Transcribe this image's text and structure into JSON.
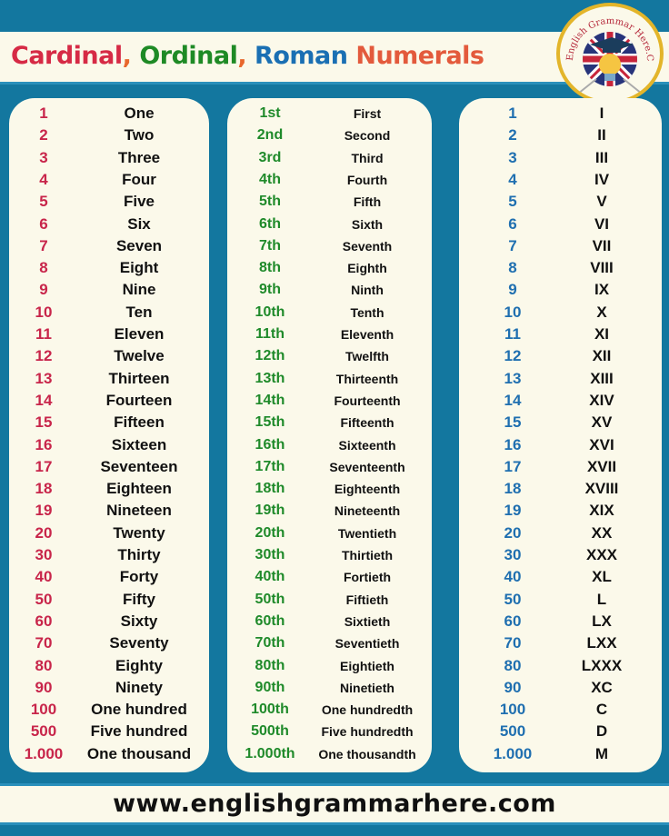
{
  "header": {
    "title_parts": {
      "cardinal": "Cardinal",
      "comma1": ",",
      "ordinal": "Ordinal",
      "comma2": ",",
      "roman": "Roman",
      "numerals": "Numerals"
    },
    "logo": {
      "text": "English Grammar Here.Com",
      "icon": "graduation-cap-lightbulb-uk-flag-icon"
    }
  },
  "colors": {
    "background": "#13779f",
    "panel": "#fbf9ea",
    "cardinal": "#c8254a",
    "ordinal": "#1f8a2a",
    "roman": "#1f6fb0",
    "numerals_title": "#e35a3c"
  },
  "cardinal": [
    {
      "num": "1",
      "word": "One"
    },
    {
      "num": "2",
      "word": "Two"
    },
    {
      "num": "3",
      "word": "Three"
    },
    {
      "num": "4",
      "word": "Four"
    },
    {
      "num": "5",
      "word": "Five"
    },
    {
      "num": "6",
      "word": "Six"
    },
    {
      "num": "7",
      "word": "Seven"
    },
    {
      "num": "8",
      "word": "Eight"
    },
    {
      "num": "9",
      "word": "Nine"
    },
    {
      "num": "10",
      "word": "Ten"
    },
    {
      "num": "11",
      "word": "Eleven"
    },
    {
      "num": "12",
      "word": "Twelve"
    },
    {
      "num": "13",
      "word": "Thirteen"
    },
    {
      "num": "14",
      "word": "Fourteen"
    },
    {
      "num": "15",
      "word": "Fifteen"
    },
    {
      "num": "16",
      "word": "Sixteen"
    },
    {
      "num": "17",
      "word": "Seventeen"
    },
    {
      "num": "18",
      "word": "Eighteen"
    },
    {
      "num": "19",
      "word": "Nineteen"
    },
    {
      "num": "20",
      "word": "Twenty"
    },
    {
      "num": "30",
      "word": "Thirty"
    },
    {
      "num": "40",
      "word": "Forty"
    },
    {
      "num": "50",
      "word": "Fifty"
    },
    {
      "num": "60",
      "word": "Sixty"
    },
    {
      "num": "70",
      "word": "Seventy"
    },
    {
      "num": "80",
      "word": "Eighty"
    },
    {
      "num": "90",
      "word": "Ninety"
    },
    {
      "num": "100",
      "word": "One hundred"
    },
    {
      "num": "500",
      "word": "Five hundred"
    },
    {
      "num": "1.000",
      "word": "One thousand"
    }
  ],
  "ordinal": [
    {
      "num": "1st",
      "word": "First"
    },
    {
      "num": "2nd",
      "word": "Second"
    },
    {
      "num": "3rd",
      "word": "Third"
    },
    {
      "num": "4th",
      "word": "Fourth"
    },
    {
      "num": "5th",
      "word": "Fifth"
    },
    {
      "num": "6th",
      "word": "Sixth"
    },
    {
      "num": "7th",
      "word": "Seventh"
    },
    {
      "num": "8th",
      "word": "Eighth"
    },
    {
      "num": "9th",
      "word": "Ninth"
    },
    {
      "num": "10th",
      "word": "Tenth"
    },
    {
      "num": "11th",
      "word": "Eleventh"
    },
    {
      "num": "12th",
      "word": "Twelfth"
    },
    {
      "num": "13th",
      "word": "Thirteenth"
    },
    {
      "num": "14th",
      "word": "Fourteenth"
    },
    {
      "num": "15th",
      "word": "Fifteenth"
    },
    {
      "num": "16th",
      "word": "Sixteenth"
    },
    {
      "num": "17th",
      "word": "Seventeenth"
    },
    {
      "num": "18th",
      "word": "Eighteenth"
    },
    {
      "num": "19th",
      "word": "Nineteenth"
    },
    {
      "num": "20th",
      "word": "Twentieth"
    },
    {
      "num": "30th",
      "word": "Thirtieth"
    },
    {
      "num": "40th",
      "word": "Fortieth"
    },
    {
      "num": "50th",
      "word": "Fiftieth"
    },
    {
      "num": "60th",
      "word": "Sixtieth"
    },
    {
      "num": "70th",
      "word": "Seventieth"
    },
    {
      "num": "80th",
      "word": "Eightieth"
    },
    {
      "num": "90th",
      "word": "Ninetieth"
    },
    {
      "num": "100th",
      "word": "One hundredth"
    },
    {
      "num": "500th",
      "word": "Five hundredth"
    },
    {
      "num": "1.000th",
      "word": "One thousandth"
    }
  ],
  "roman": [
    {
      "num": "1",
      "word": "I"
    },
    {
      "num": "2",
      "word": "II"
    },
    {
      "num": "3",
      "word": "III"
    },
    {
      "num": "4",
      "word": "IV"
    },
    {
      "num": "5",
      "word": "V"
    },
    {
      "num": "6",
      "word": "VI"
    },
    {
      "num": "7",
      "word": "VII"
    },
    {
      "num": "8",
      "word": "VIII"
    },
    {
      "num": "9",
      "word": "IX"
    },
    {
      "num": "10",
      "word": "X"
    },
    {
      "num": "11",
      "word": "XI"
    },
    {
      "num": "12",
      "word": "XII"
    },
    {
      "num": "13",
      "word": "XIII"
    },
    {
      "num": "14",
      "word": "XIV"
    },
    {
      "num": "15",
      "word": "XV"
    },
    {
      "num": "16",
      "word": "XVI"
    },
    {
      "num": "17",
      "word": "XVII"
    },
    {
      "num": "18",
      "word": "XVIII"
    },
    {
      "num": "19",
      "word": "XIX"
    },
    {
      "num": "20",
      "word": "XX"
    },
    {
      "num": "30",
      "word": "XXX"
    },
    {
      "num": "40",
      "word": "XL"
    },
    {
      "num": "50",
      "word": "L"
    },
    {
      "num": "60",
      "word": "LX"
    },
    {
      "num": "70",
      "word": "LXX"
    },
    {
      "num": "80",
      "word": "LXXX"
    },
    {
      "num": "90",
      "word": "XC"
    },
    {
      "num": "100",
      "word": "C"
    },
    {
      "num": "500",
      "word": "D"
    },
    {
      "num": "1.000",
      "word": "M"
    }
  ],
  "footer": {
    "url": "www.englishgrammarhere.com"
  }
}
